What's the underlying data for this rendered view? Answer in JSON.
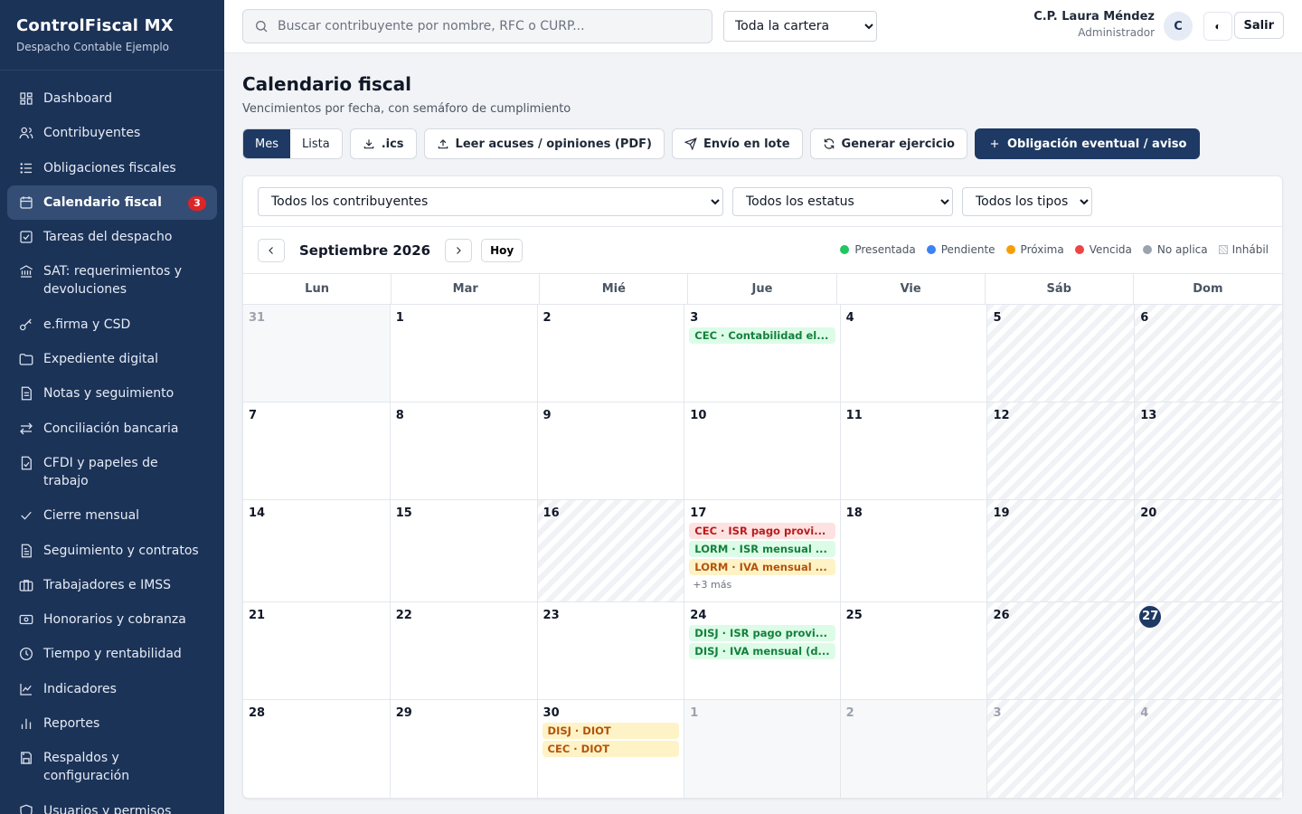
{
  "brand": {
    "title": "ControlFiscal MX",
    "subtitle": "Despacho Contable Ejemplo"
  },
  "sidebar": {
    "items": [
      {
        "label": "Dashboard",
        "icon": "dashboard-icon"
      },
      {
        "label": "Contribuyentes",
        "icon": "users-icon"
      },
      {
        "label": "Obligaciones fiscales",
        "icon": "list-icon"
      },
      {
        "label": "Calendario fiscal",
        "icon": "calendar-icon",
        "active": true,
        "badge": "3"
      },
      {
        "label": "Tareas del despacho",
        "icon": "checkbox-icon"
      },
      {
        "label": "SAT: requerimientos y devoluciones",
        "icon": "bank-icon"
      },
      {
        "label": "e.firma y CSD",
        "icon": "key-icon"
      },
      {
        "label": "Expediente digital",
        "icon": "folder-icon"
      },
      {
        "label": "Notas y seguimiento",
        "icon": "document-icon"
      },
      {
        "label": "Conciliación bancaria",
        "icon": "transfer-icon"
      },
      {
        "label": "CFDI y papeles de trabajo",
        "icon": "file-check-icon"
      },
      {
        "label": "Cierre mensual",
        "icon": "check-icon"
      },
      {
        "label": "Seguimiento y contratos",
        "icon": "contract-icon"
      },
      {
        "label": "Trabajadores e IMSS",
        "icon": "briefcase-icon"
      },
      {
        "label": "Honorarios y cobranza",
        "icon": "money-icon"
      },
      {
        "label": "Tiempo y rentabilidad",
        "icon": "clock-icon"
      },
      {
        "label": "Indicadores",
        "icon": "trend-icon"
      },
      {
        "label": "Reportes",
        "icon": "bar-chart-icon"
      },
      {
        "label": "Respaldos y configuración",
        "icon": "save-icon"
      },
      {
        "label": "Usuarios y permisos",
        "icon": "shield-icon"
      }
    ]
  },
  "topbar": {
    "search_placeholder": "Buscar contribuyente por nombre, RFC o CURP...",
    "cartera_selected": "Toda la cartera",
    "user_name": "C.P. Laura Méndez",
    "user_role": "Administrador",
    "avatar_initial": "C",
    "theme_glyph": "◐",
    "logout_label": "Salir"
  },
  "page": {
    "title": "Calendario fiscal",
    "subtitle": "Vencimientos por fecha, con semáforo de cumplimiento"
  },
  "toolbar": {
    "view_month": "Mes",
    "view_list": "Lista",
    "ics": ".ics",
    "read_acks": "Leer acuses / opiniones (PDF)",
    "batch_send": "Envío en lote",
    "generate": "Generar ejercicio",
    "add_obligation": "Obligación eventual / aviso"
  },
  "filters": {
    "taxpayers": "Todos los contribuyentes",
    "statuses": "Todos los estatus",
    "types": "Todos los tipos"
  },
  "calendar": {
    "month_label": "Septiembre 2026",
    "today_label": "Hoy",
    "legend": [
      {
        "label": "Presentada",
        "color": "#22c55e"
      },
      {
        "label": "Pendiente",
        "color": "#3b82f6"
      },
      {
        "label": "Próxima",
        "color": "#f59e0b"
      },
      {
        "label": "Vencida",
        "color": "#ef4444"
      },
      {
        "label": "No aplica",
        "color": "#9ca3af"
      }
    ],
    "legend_hatch": "Inhábil",
    "weekdays": [
      "Lun",
      "Mar",
      "Mié",
      "Jue",
      "Vie",
      "Sáb",
      "Dom"
    ],
    "weeks": [
      [
        {
          "day": "31",
          "out": true
        },
        {
          "day": "1"
        },
        {
          "day": "2"
        },
        {
          "day": "3",
          "events": [
            {
              "text": "CEC · Contabilidad el...",
              "color": "green"
            }
          ]
        },
        {
          "day": "4"
        },
        {
          "day": "5",
          "hatch": true
        },
        {
          "day": "6",
          "hatch": true
        }
      ],
      [
        {
          "day": "7"
        },
        {
          "day": "8"
        },
        {
          "day": "9"
        },
        {
          "day": "10"
        },
        {
          "day": "11"
        },
        {
          "day": "12",
          "hatch": true
        },
        {
          "day": "13",
          "hatch": true
        }
      ],
      [
        {
          "day": "14"
        },
        {
          "day": "15"
        },
        {
          "day": "16",
          "hatch": true
        },
        {
          "day": "17",
          "events": [
            {
              "text": "CEC · ISR pago provi...",
              "color": "red"
            },
            {
              "text": "LORM · ISR mensual ...",
              "color": "green"
            },
            {
              "text": "LORM · IVA mensual ...",
              "color": "orange"
            }
          ],
          "more": "+3 más"
        },
        {
          "day": "18"
        },
        {
          "day": "19",
          "hatch": true
        },
        {
          "day": "20",
          "hatch": true
        }
      ],
      [
        {
          "day": "21"
        },
        {
          "day": "22"
        },
        {
          "day": "23"
        },
        {
          "day": "24",
          "events": [
            {
              "text": "DISJ · ISR pago provi...",
              "color": "green"
            },
            {
              "text": "DISJ · IVA mensual (d...",
              "color": "green"
            }
          ]
        },
        {
          "day": "25"
        },
        {
          "day": "26",
          "hatch": true
        },
        {
          "day": "27",
          "hatch": true,
          "today": true
        }
      ],
      [
        {
          "day": "28"
        },
        {
          "day": "29"
        },
        {
          "day": "30",
          "events": [
            {
              "text": "DISJ · DIOT",
              "color": "orange"
            },
            {
              "text": "CEC · DIOT",
              "color": "orange"
            }
          ]
        },
        {
          "day": "1",
          "out": true
        },
        {
          "day": "2",
          "out": true
        },
        {
          "day": "3",
          "out": true,
          "hatch": true
        },
        {
          "day": "4",
          "out": true,
          "hatch": true
        }
      ]
    ]
  }
}
